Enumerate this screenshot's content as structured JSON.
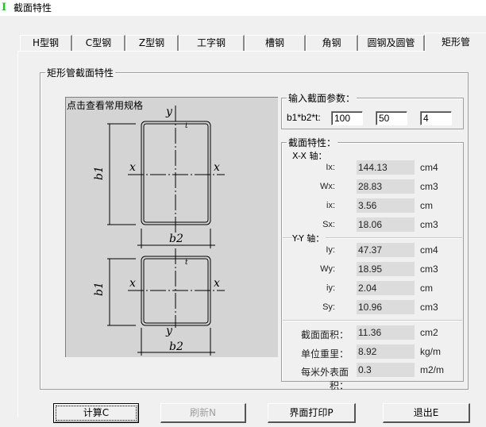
{
  "window": {
    "title": "截面特性",
    "icon": "i-beam-icon"
  },
  "tabs": [
    "H型钢",
    "C型钢",
    "Z型钢",
    "工字钢",
    "槽钢",
    "角钢",
    "圆钢及圆管",
    "矩形管"
  ],
  "active_tab": "矩形管",
  "group_title": "矩形管截面特性",
  "drawing": {
    "hint": "点击查看常用规格",
    "labels": {
      "y": "y",
      "x": "x",
      "b1": "b1",
      "b2": "b2",
      "t": "t"
    }
  },
  "input": {
    "title": "输入截面参数：",
    "label": "b1*b2*t:",
    "b1": "100",
    "b2": "50",
    "t": "4"
  },
  "props": {
    "title": "截面特性：",
    "xx_label": "X-X 轴：",
    "yy_label": "Y-Y 轴：",
    "rows": [
      {
        "label": "Ix:",
        "value": "144.13",
        "unit": "cm4"
      },
      {
        "label": "Wx:",
        "value": "28.83",
        "unit": "cm3"
      },
      {
        "label": "ix:",
        "value": "3.56",
        "unit": "cm"
      },
      {
        "label": "Sx:",
        "value": "18.06",
        "unit": "cm3"
      },
      {
        "label": "Iy:",
        "value": "47.37",
        "unit": "cm4"
      },
      {
        "label": "Wy:",
        "value": "18.95",
        "unit": "cm3"
      },
      {
        "label": "iy:",
        "value": "2.04",
        "unit": "cm"
      },
      {
        "label": "Sy:",
        "value": "10.96",
        "unit": "cm3"
      },
      {
        "label": "截面面积：",
        "value": "11.36",
        "unit": "cm2"
      },
      {
        "label": "单位重里：",
        "value": "8.92",
        "unit": "kg/m"
      },
      {
        "label": "每米外表面积：",
        "value": "0.3",
        "unit": "m2/m"
      }
    ]
  },
  "buttons": {
    "calc": "计算C",
    "refresh": "刷新N",
    "print": "界面打印P",
    "exit": "退出E"
  }
}
